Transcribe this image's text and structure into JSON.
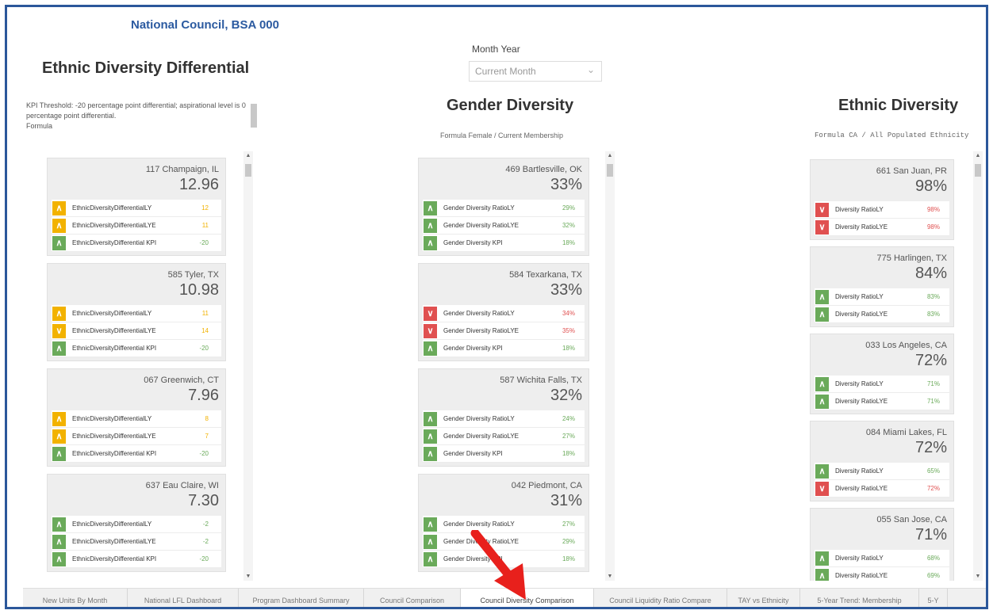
{
  "header": {
    "org_name": "National Council, BSA 000"
  },
  "filter": {
    "label": "Month Year",
    "value": "Current Month",
    "chevron_icon": "chevron-down-icon"
  },
  "colors": {
    "up": "#6aaa5a",
    "warn": "#f2b200",
    "down": "#e05050",
    "accent": "#2b579a"
  },
  "panels": [
    {
      "title": "Ethnic Diversity Differential",
      "kpi_text": "KPI Threshold: -20 percentage point differential; aspirational level is 0 percentage point differential.",
      "formula": "Formula",
      "cards": [
        {
          "city": "117 Champaign, IL",
          "value": "12.96",
          "rows": [
            {
              "icon": "chevron-up-icon",
              "status": "warn",
              "label": "EthnicDiversityDifferentialLY",
              "num": "12"
            },
            {
              "icon": "chevron-up-icon",
              "status": "warn",
              "label": "EthnicDiversityDifferentialLYE",
              "num": "11"
            },
            {
              "icon": "chevron-up-icon",
              "status": "up",
              "label": "EthnicDiversityDifferential KPI",
              "num": "-20"
            }
          ]
        },
        {
          "city": "585 Tyler, TX",
          "value": "10.98",
          "rows": [
            {
              "icon": "chevron-up-icon",
              "status": "warn",
              "label": "EthnicDiversityDifferentialLY",
              "num": "11"
            },
            {
              "icon": "chevron-down-icon",
              "status": "warn",
              "label": "EthnicDiversityDifferentialLYE",
              "num": "14"
            },
            {
              "icon": "chevron-up-icon",
              "status": "up",
              "label": "EthnicDiversityDifferential KPI",
              "num": "-20"
            }
          ]
        },
        {
          "city": "067 Greenwich, CT",
          "value": "7.96",
          "rows": [
            {
              "icon": "chevron-up-icon",
              "status": "warn",
              "label": "EthnicDiversityDifferentialLY",
              "num": "8"
            },
            {
              "icon": "chevron-up-icon",
              "status": "warn",
              "label": "EthnicDiversityDifferentialLYE",
              "num": "7"
            },
            {
              "icon": "chevron-up-icon",
              "status": "up",
              "label": "EthnicDiversityDifferential KPI",
              "num": "-20"
            }
          ]
        },
        {
          "city": "637 Eau Claire, WI",
          "value": "7.30",
          "rows": [
            {
              "icon": "chevron-up-icon",
              "status": "up",
              "label": "EthnicDiversityDifferentialLY",
              "num": "-2"
            },
            {
              "icon": "chevron-up-icon",
              "status": "up",
              "label": "EthnicDiversityDifferentialLYE",
              "num": "-2"
            },
            {
              "icon": "chevron-up-icon",
              "status": "up",
              "label": "EthnicDiversityDifferential KPI",
              "num": "-20"
            }
          ]
        }
      ]
    },
    {
      "title": "Gender Diversity",
      "formula": "Formula Female / Current Membership",
      "cards": [
        {
          "city": "469 Bartlesville, OK",
          "value": "33%",
          "rows": [
            {
              "icon": "chevron-up-icon",
              "status": "up",
              "label": "Gender Diversity RatioLY",
              "num": "29%"
            },
            {
              "icon": "chevron-up-icon",
              "status": "up",
              "label": "Gender Diversity RatioLYE",
              "num": "32%"
            },
            {
              "icon": "chevron-up-icon",
              "status": "up",
              "label": "Gender Diversity KPI",
              "num": "18%"
            }
          ]
        },
        {
          "city": "584 Texarkana, TX",
          "value": "33%",
          "rows": [
            {
              "icon": "chevron-down-icon",
              "status": "down",
              "label": "Gender Diversity RatioLY",
              "num": "34%"
            },
            {
              "icon": "chevron-down-icon",
              "status": "down",
              "label": "Gender Diversity RatioLYE",
              "num": "35%"
            },
            {
              "icon": "chevron-up-icon",
              "status": "up",
              "label": "Gender Diversity KPI",
              "num": "18%"
            }
          ]
        },
        {
          "city": "587 Wichita Falls, TX",
          "value": "32%",
          "rows": [
            {
              "icon": "chevron-up-icon",
              "status": "up",
              "label": "Gender Diversity RatioLY",
              "num": "24%"
            },
            {
              "icon": "chevron-up-icon",
              "status": "up",
              "label": "Gender Diversity RatioLYE",
              "num": "27%"
            },
            {
              "icon": "chevron-up-icon",
              "status": "up",
              "label": "Gender Diversity KPI",
              "num": "18%"
            }
          ]
        },
        {
          "city": "042 Piedmont, CA",
          "value": "31%",
          "rows": [
            {
              "icon": "chevron-up-icon",
              "status": "up",
              "label": "Gender Diversity RatioLY",
              "num": "27%"
            },
            {
              "icon": "chevron-up-icon",
              "status": "up",
              "label": "Gender Diversity RatioLYE",
              "num": "29%"
            },
            {
              "icon": "chevron-up-icon",
              "status": "up",
              "label": "Gender Diversity KPI",
              "num": "18%"
            }
          ]
        }
      ]
    },
    {
      "title": "Ethnic Diversity",
      "formula": "Formula CA / All Populated Ethnicity",
      "cards": [
        {
          "city": "661 San Juan, PR",
          "value": "98%",
          "rows": [
            {
              "icon": "chevron-down-icon",
              "status": "down",
              "label": "Diversity RatioLY",
              "num": "98%"
            },
            {
              "icon": "chevron-down-icon",
              "status": "down",
              "label": "Diversity RatioLYE",
              "num": "98%"
            }
          ]
        },
        {
          "city": "775 Harlingen, TX",
          "value": "84%",
          "rows": [
            {
              "icon": "chevron-up-icon",
              "status": "up",
              "label": "Diversity RatioLY",
              "num": "83%"
            },
            {
              "icon": "chevron-up-icon",
              "status": "up",
              "label": "Diversity RatioLYE",
              "num": "83%"
            }
          ]
        },
        {
          "city": "033 Los Angeles, CA",
          "value": "72%",
          "rows": [
            {
              "icon": "chevron-up-icon",
              "status": "up",
              "label": "Diversity RatioLY",
              "num": "71%"
            },
            {
              "icon": "chevron-up-icon",
              "status": "up",
              "label": "Diversity RatioLYE",
              "num": "71%"
            }
          ]
        },
        {
          "city": "084 Miami Lakes, FL",
          "value": "72%",
          "rows": [
            {
              "icon": "chevron-up-icon",
              "status": "up",
              "label": "Diversity RatioLY",
              "num": "65%"
            },
            {
              "icon": "chevron-down-icon",
              "status": "down",
              "label": "Diversity RatioLYE",
              "num": "72%"
            }
          ]
        },
        {
          "city": "055 San Jose, CA",
          "value": "71%",
          "rows": [
            {
              "icon": "chevron-up-icon",
              "status": "up",
              "label": "Diversity RatioLY",
              "num": "68%"
            },
            {
              "icon": "chevron-up-icon",
              "status": "up",
              "label": "Diversity RatioLYE",
              "num": "69%"
            }
          ]
        }
      ]
    }
  ],
  "tabs": [
    {
      "label": "New Units By Month"
    },
    {
      "label": "National LFL Dashboard"
    },
    {
      "label": "Program Dashboard Summary"
    },
    {
      "label": "Council Comparison"
    },
    {
      "label": "Council Diversity Comparison",
      "active": true
    },
    {
      "label": "Council Liquidity Ratio Compare"
    },
    {
      "label": "TAY vs Ethnicity"
    },
    {
      "label": "5-Year Trend: Membership"
    },
    {
      "label": "5-Y"
    }
  ]
}
